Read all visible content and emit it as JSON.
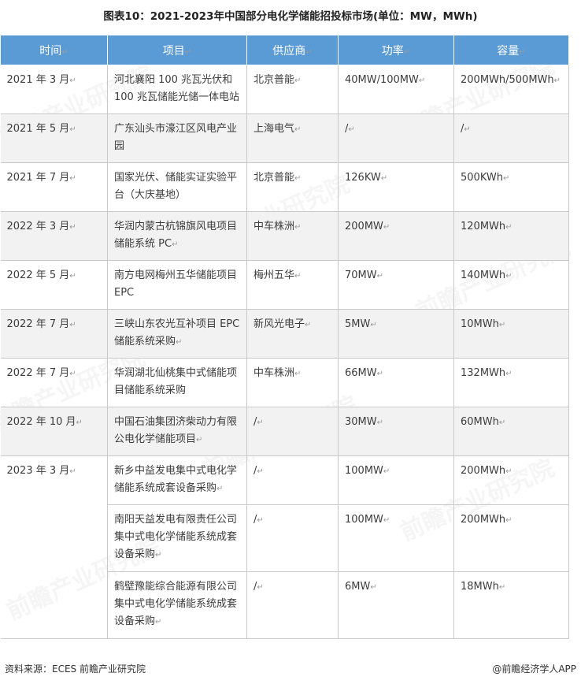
{
  "title": "图表10：2021-2023年中国部分电化学储能招投标市场(单位：MW，MWh)",
  "headers": [
    "时间",
    "项目",
    "供应商",
    "功率",
    "容量"
  ],
  "rows": [
    {
      "time": "2021 年 3 月",
      "project": "河北襄阳 100 兆瓦光伏和100 兆瓦储能光储一体电站",
      "supplier": "北京普能",
      "power": "40MW/100MW",
      "capacity": "200MWh/500MWh"
    },
    {
      "time": "2021 年 5 月",
      "project": "广东汕头市濠江区风电产业园",
      "supplier": "上海电气",
      "power": "/",
      "capacity": "/"
    },
    {
      "time": "2021 年 7 月",
      "project": "国家光伏、储能实证实验平台（大庆基地）",
      "supplier": "北京普能",
      "power": "126KW",
      "capacity": "500KWh"
    },
    {
      "time": "2022 年 3 月",
      "project": "华润内蒙古杭锦旗风电项目储能系统 PC",
      "supplier": "中车株洲",
      "power": "200MW",
      "capacity": "120MWh"
    },
    {
      "time": "2022 年 5 月",
      "project": "南方电网梅州五华储能项目EPC",
      "supplier": "梅州五华",
      "power": "70MW",
      "capacity": "140MWh"
    },
    {
      "time": "2022 年 7 月",
      "project": "三峡山东农光互补项目 EPC储能系统采购",
      "supplier": "新风光电子",
      "power": "5MW",
      "capacity": "10MWh"
    },
    {
      "time": "2022 年 7 月",
      "project": "华润湖北仙桃集中式储能项目储能系统采购",
      "supplier": "中车株洲",
      "power": "66MW",
      "capacity": "132MWh"
    },
    {
      "time": "2022 年 10 月",
      "project": "中国石油集团济柴动力有限公电化学储能项目",
      "supplier": "/",
      "power": "30MW",
      "capacity": "60MWh"
    },
    {
      "time": "2023 年 3 月",
      "project": "新乡中益发电集中式电化学储能系统成套设备采购",
      "supplier": "/",
      "power": "100MW",
      "capacity": "200MWh"
    },
    {
      "time": "",
      "project": "南阳天益发电有限责任公司集中式电化学储能系统成套设备采购",
      "supplier": "/",
      "power": "100MW",
      "capacity": "200MWh"
    },
    {
      "time": "",
      "project": "鹤壁豫能综合能源有限公司集中式电化学储能系统成套设备采购",
      "supplier": "/",
      "power": "6MW",
      "capacity": "18MWh"
    }
  ],
  "paragraph_mark": "↵",
  "watermark": "前瞻产业研究院",
  "footer": {
    "source": "资料来源：ECES 前瞻产业研究院",
    "brand": "@前瞻经济学人APP"
  }
}
